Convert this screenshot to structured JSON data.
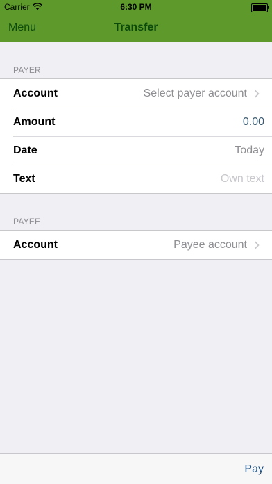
{
  "status_bar": {
    "carrier": "Carrier",
    "time": "6:30 PM",
    "wifi_icon": "wifi-icon",
    "battery_icon": "battery-icon"
  },
  "nav": {
    "menu_label": "Menu",
    "title": "Transfer"
  },
  "payer": {
    "section_label": "PAYER",
    "rows": [
      {
        "label": "Account",
        "value": "Select payer account",
        "icon": "chevron-right-icon"
      },
      {
        "label": "Amount",
        "value": "0.00"
      },
      {
        "label": "Date",
        "value": "Today"
      },
      {
        "label": "Text",
        "placeholder": "Own text"
      }
    ]
  },
  "payee": {
    "section_label": "PAYEE",
    "rows": [
      {
        "label": "Account",
        "value": "Payee account",
        "icon": "chevron-right-icon"
      }
    ]
  },
  "toolbar": {
    "pay_label": "Pay"
  },
  "colors": {
    "header_green": "#5e9a2b",
    "nav_text": "#0c4a0c",
    "background": "#efeff4",
    "pay_blue": "#1f4f7e"
  }
}
